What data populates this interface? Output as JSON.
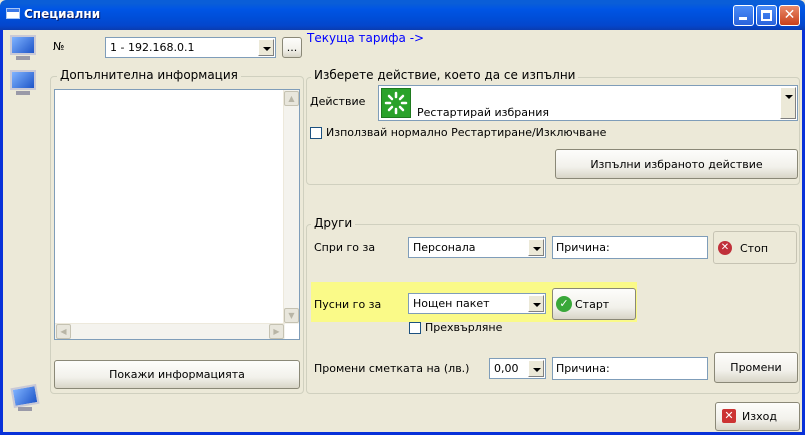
{
  "window": {
    "title": "Специални"
  },
  "top": {
    "number_label": "№",
    "computer_select": "1 - 192.168.0.1",
    "browse_button": "...",
    "tariff_link": "Текуща тарифа ->"
  },
  "info_panel": {
    "title": "Допълнителна информация",
    "show_button": "Покажи информацията"
  },
  "action_panel": {
    "title": "Изберете действие, което да се изпълни",
    "action_label": "Действие",
    "action_value": "Рестартирай избрания",
    "normal_restart_checkbox": "Използвай нормално Рестартиране/Изключване",
    "execute_button": "Изпълни избраното действие"
  },
  "other_panel": {
    "title": "Други",
    "stop_for_label": "Спри го за",
    "stop_for_value": "Персонала",
    "stop_reason": "Причина:",
    "stop_button": "Стоп",
    "start_for_label": "Пусни го за",
    "start_for_value": "Нощен пакет",
    "start_button": "Старт",
    "transfer_checkbox": "Прехвърляне",
    "change_account_label": "Промени сметката на (лв.)",
    "amount_value": "0,00",
    "change_reason": "Причина:",
    "change_button": "Промени"
  },
  "footer": {
    "exit_button": "Изход"
  },
  "colors": {
    "highlight": "#fafa88",
    "title_bar": "#0055e5",
    "link": "#0000ff"
  }
}
